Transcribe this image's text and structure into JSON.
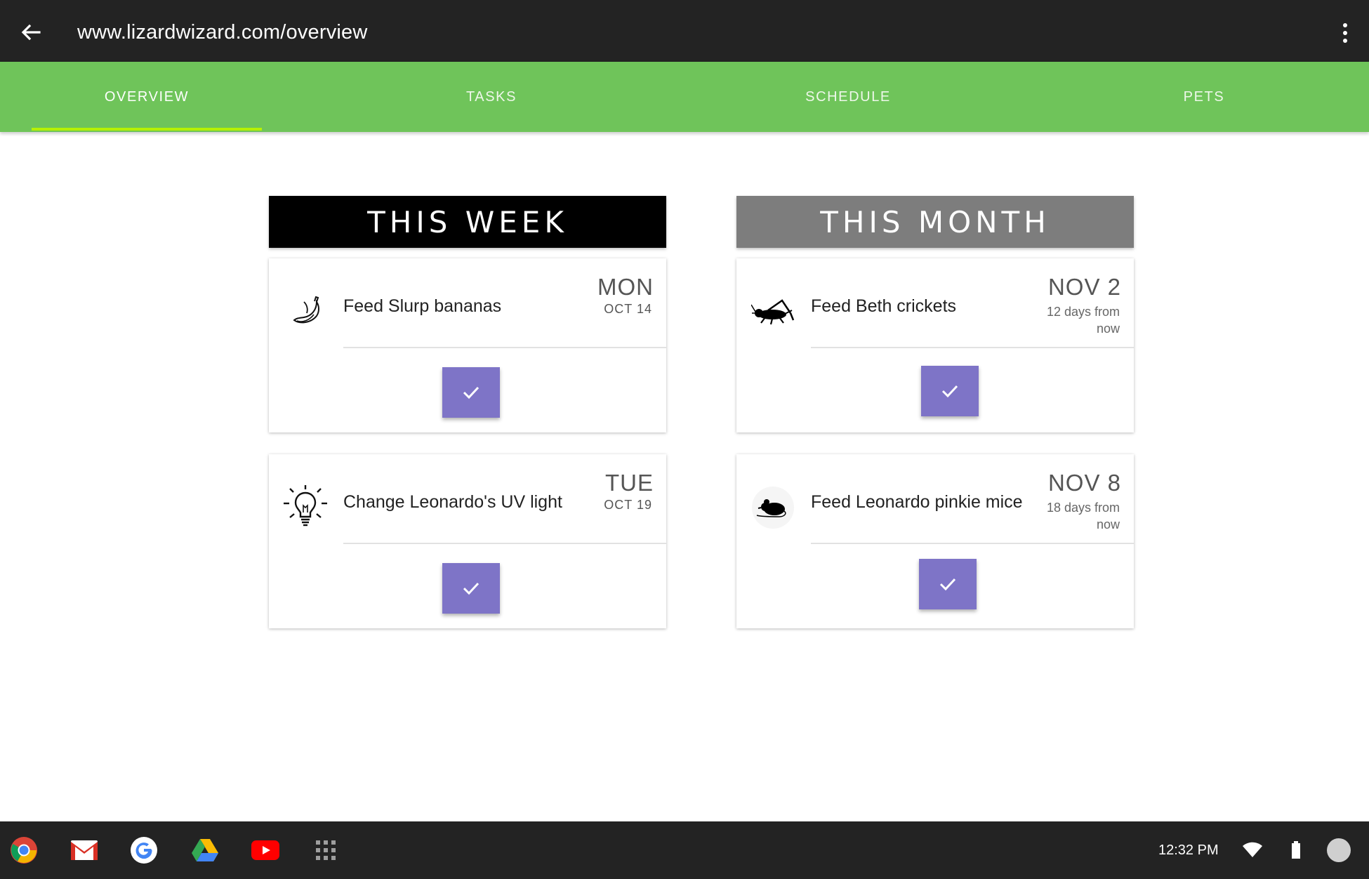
{
  "browser": {
    "url": "www.lizardwizard.com/overview",
    "back_icon": "arrow-back-icon",
    "menu_icon": "more-vert-icon"
  },
  "nav": {
    "tabs": [
      {
        "label": "OVERVIEW",
        "active": true
      },
      {
        "label": "TASKS",
        "active": false
      },
      {
        "label": "SCHEDULE",
        "active": false
      },
      {
        "label": "PETS",
        "active": false
      }
    ]
  },
  "week": {
    "header": "THIS WEEK",
    "cards": [
      {
        "title": "Feed Slurp bananas",
        "day": "MON",
        "date": "OCT 14",
        "icon": "banana-icon"
      },
      {
        "title": "Change Leonardo's UV light",
        "day": "TUE",
        "date": "OCT 19",
        "icon": "lightbulb-icon"
      }
    ]
  },
  "month": {
    "header": "THIS MONTH",
    "cards": [
      {
        "title": "Feed Beth crickets",
        "day": "NOV 2",
        "relative": "12 days from now",
        "icon": "cricket-icon"
      },
      {
        "title": "Feed Leonardo pinkie mice",
        "day": "NOV 8",
        "relative": "18 days from now",
        "icon": "mouse-icon"
      }
    ]
  },
  "shelf": {
    "apps": [
      "chrome-icon",
      "gmail-icon",
      "google-icon",
      "drive-icon",
      "youtube-icon",
      "launcher-icon"
    ],
    "time": "12:32 PM",
    "tray": [
      "wifi-icon",
      "battery-icon",
      "avatar"
    ]
  },
  "colors": {
    "navbar": "#6fc45a",
    "tab_indicator": "#b6f000",
    "check_button": "#7e74c7",
    "week_header": "#000000",
    "month_header": "#7d7d7d"
  }
}
